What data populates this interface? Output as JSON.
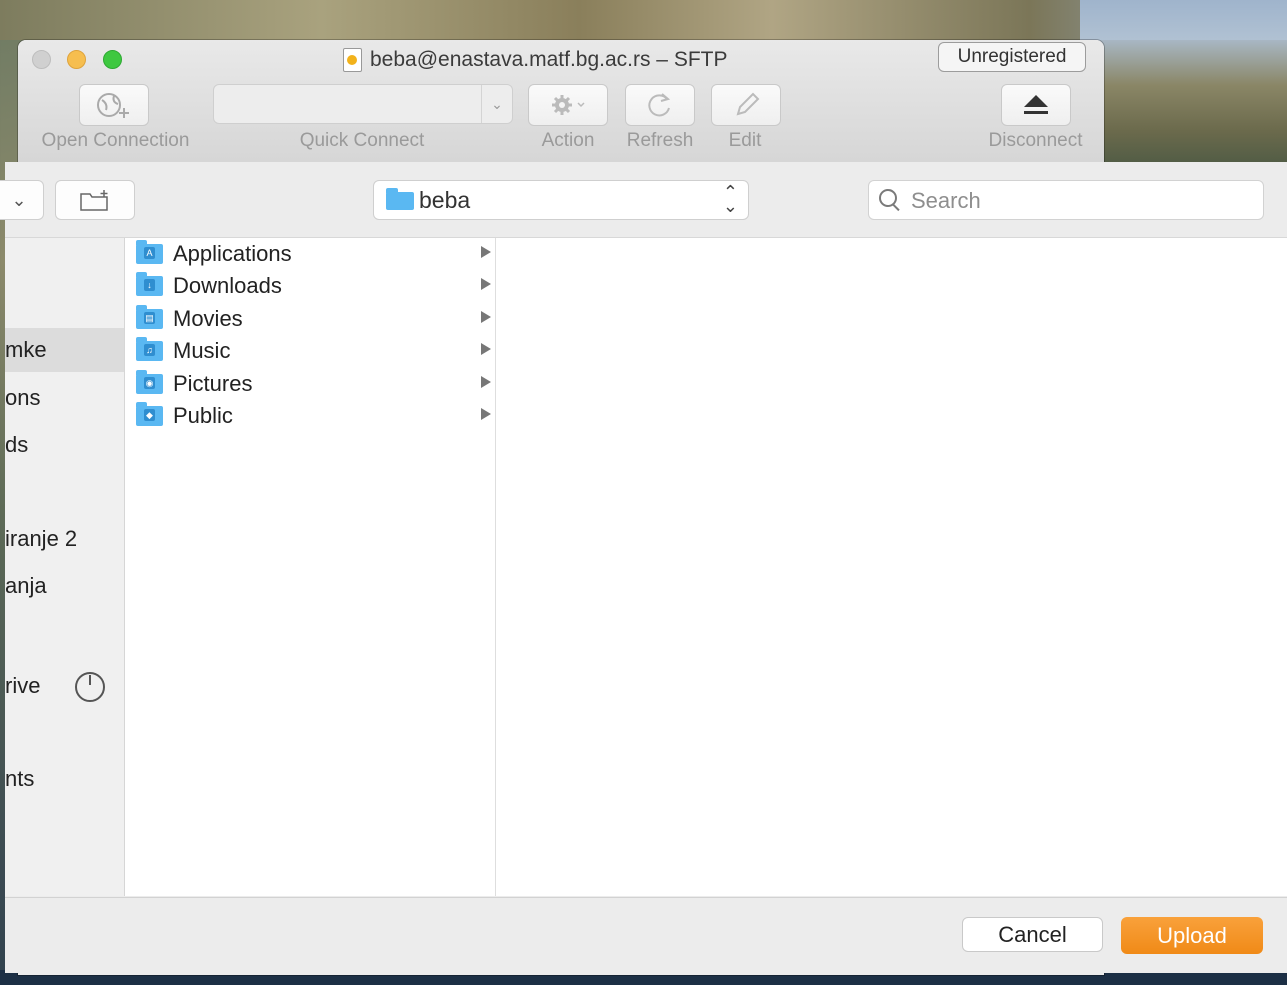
{
  "window": {
    "title": "beba@enastava.matf.bg.ac.rs – SFTP",
    "unregistered_label": "Unregistered"
  },
  "toolbar": {
    "open_connection_label": "Open Connection",
    "quick_connect_label": "Quick Connect",
    "quick_connect_value": "",
    "action_label": "Action",
    "refresh_label": "Refresh",
    "edit_label": "Edit",
    "disconnect_label": "Disconnect"
  },
  "sheet": {
    "path_label": "beba",
    "search_placeholder": "Search",
    "sidebar_items": [
      {
        "label": "mke"
      },
      {
        "label": "ons"
      },
      {
        "label": "ds"
      },
      {
        "label": "iranje 2"
      },
      {
        "label": "anja"
      },
      {
        "label": "rive"
      },
      {
        "label": "nts"
      }
    ],
    "folders": [
      {
        "name": "Applications",
        "icon": "applications-folder-icon",
        "glyph": "A"
      },
      {
        "name": "Downloads",
        "icon": "downloads-folder-icon",
        "glyph": "↓"
      },
      {
        "name": "Movies",
        "icon": "movies-folder-icon",
        "glyph": "▤"
      },
      {
        "name": "Music",
        "icon": "music-folder-icon",
        "glyph": "♫"
      },
      {
        "name": "Pictures",
        "icon": "pictures-folder-icon",
        "glyph": "◉"
      },
      {
        "name": "Public",
        "icon": "public-folder-icon",
        "glyph": "◆"
      }
    ],
    "cancel_label": "Cancel",
    "upload_label": "Upload"
  },
  "colors": {
    "accent": "#f08a17",
    "folder": "#5ab8f2"
  }
}
